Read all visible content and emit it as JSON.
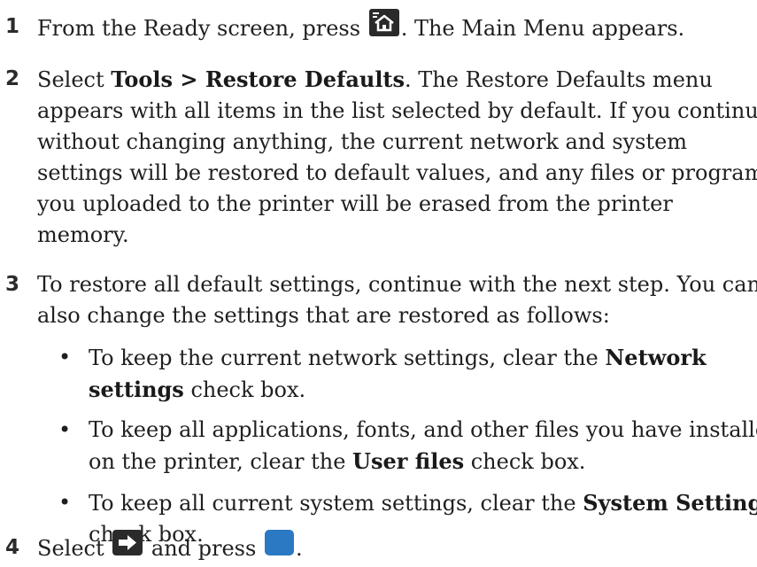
{
  "steps": [
    {
      "number": "1",
      "lines": [
        {
          "before": "From the Ready screen, press ",
          "after": ". The Main Menu appears."
        }
      ],
      "icon": "home-menu-icon"
    },
    {
      "number": "2",
      "select_label": "Select ",
      "bold": "Tools > Restore Defaults",
      "line1_rest": ". The Restore Defaults menu",
      "lines": [
        "appears with all items in the list selected by default. If you continue",
        "without changing anything, the current network and system",
        "settings will be restored to default values, and any files or programs",
        "you uploaded to the printer will be erased from the printer",
        "memory."
      ]
    },
    {
      "number": "3",
      "lines": [
        "To restore all default settings, continue with the next step. You can",
        "also change the settings that are restored as follows:"
      ],
      "bullets": [
        {
          "pre": "To keep the current network settings, clear the ",
          "bold1": "Network",
          "bold2": "settings",
          "post": " check box."
        },
        {
          "line1": "To keep all applications, fonts, and other files you have installed",
          "pre": "on the printer, clear the ",
          "bold": "User files",
          "post": " check box."
        },
        {
          "pre": "To keep all current system settings, clear the ",
          "bold": "System Settings",
          "line2": "check box."
        }
      ]
    },
    {
      "number": "4",
      "before": "Select ",
      "middle": " and press ",
      "after": ".",
      "icons": [
        "arrow-right-icon",
        "enter-button-icon"
      ]
    }
  ],
  "colors": {
    "text": "#1f1f1f",
    "icon_dark": "#2a2a2a",
    "icon_blue": "#2b79c2"
  }
}
